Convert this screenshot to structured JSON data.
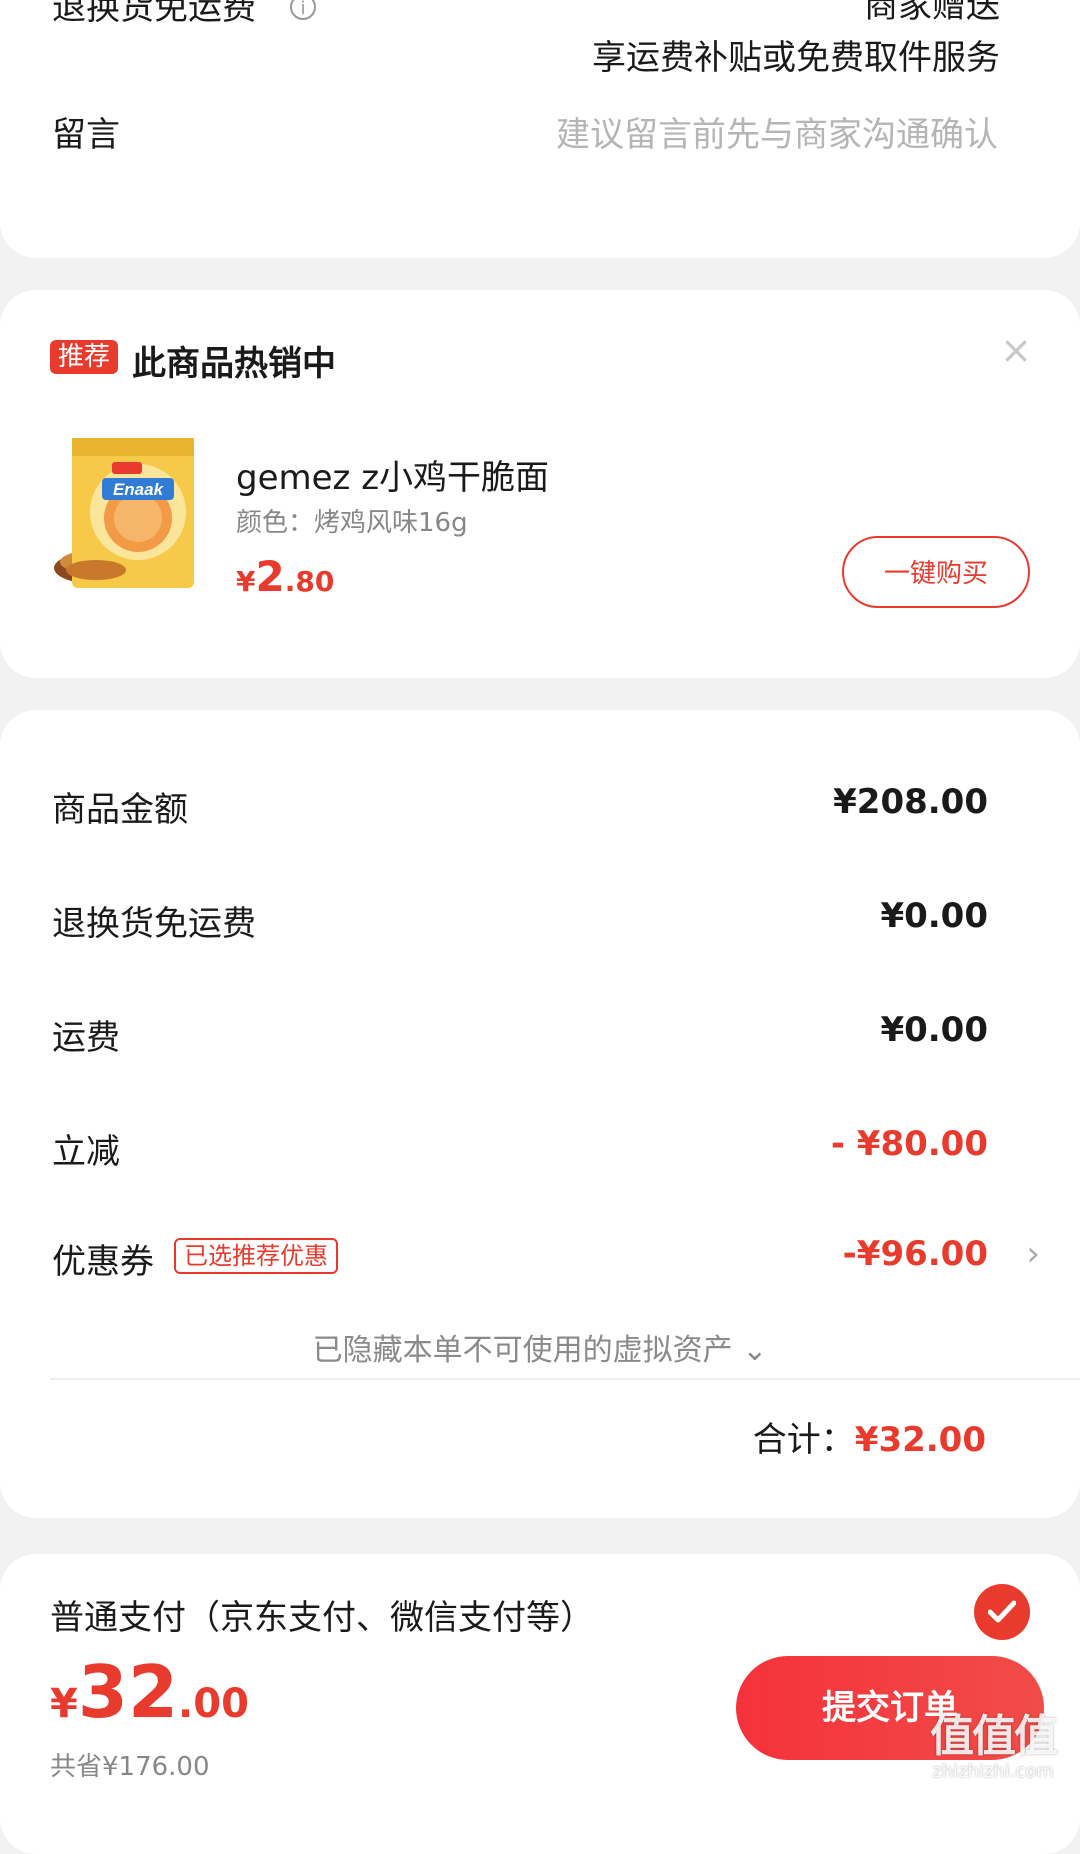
{
  "top_section": {
    "return_label": "退换货免运费",
    "return_right_top": "商家赠送",
    "return_right_bottom": "享运费补贴或免费取件服务",
    "message_label": "留言",
    "message_placeholder": "建议留言前先与商家沟通确认"
  },
  "recommend": {
    "tag": "推荐",
    "title": "此商品热销中",
    "product": {
      "name": "gemez z小鸡干脆面",
      "spec": "颜色：烤鸡风味16g",
      "price_currency": "¥",
      "price_int": "2",
      "price_dec": ".80"
    },
    "buy_button": "一键购买"
  },
  "summary": {
    "rows": [
      {
        "label": "商品金额",
        "value": "¥208.00"
      },
      {
        "label": "退换货免运费",
        "value": "¥0.00"
      },
      {
        "label": "运费",
        "value": "¥0.00"
      },
      {
        "label": "立减",
        "value": "- ¥80.00"
      },
      {
        "label": "优惠券",
        "value": "-¥96.00",
        "tag": "已选推荐优惠"
      }
    ],
    "hidden_assets_text": "已隐藏本单不可使用的虚拟资产",
    "total_label": "合计：",
    "total_value": "¥32.00"
  },
  "payment": {
    "method_label": "普通支付（京东支付、微信支付等）"
  },
  "bottom_bar": {
    "price_currency": "¥",
    "price_int": "32",
    "price_dec": ".00",
    "saved_text": "共省¥176.00",
    "submit_button": "提交订单"
  },
  "watermark": {
    "main": "值值值",
    "sub": "zhizhizhi.com"
  },
  "colors": {
    "accent": "#e93b2d",
    "background": "#f2f2f2"
  }
}
